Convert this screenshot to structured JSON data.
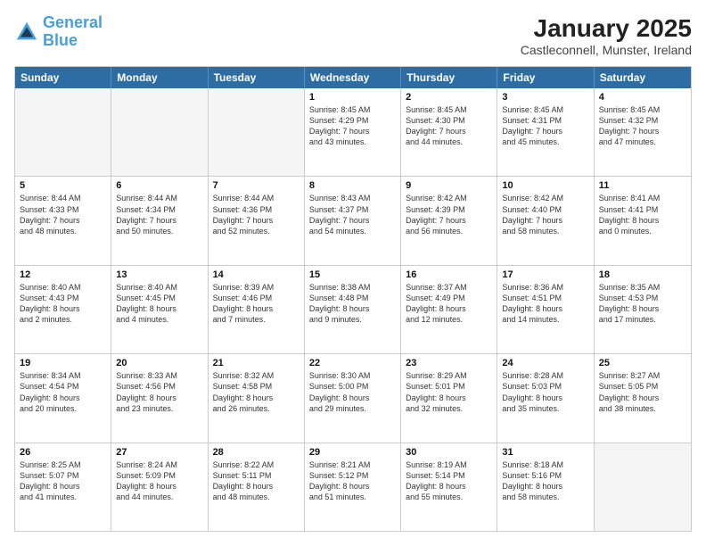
{
  "logo": {
    "line1": "General",
    "line2": "Blue"
  },
  "title": "January 2025",
  "location": "Castleconnell, Munster, Ireland",
  "header_days": [
    "Sunday",
    "Monday",
    "Tuesday",
    "Wednesday",
    "Thursday",
    "Friday",
    "Saturday"
  ],
  "weeks": [
    [
      {
        "day": "",
        "info": "",
        "empty": true
      },
      {
        "day": "",
        "info": "",
        "empty": true
      },
      {
        "day": "",
        "info": "",
        "empty": true
      },
      {
        "day": "1",
        "info": "Sunrise: 8:45 AM\nSunset: 4:29 PM\nDaylight: 7 hours\nand 43 minutes."
      },
      {
        "day": "2",
        "info": "Sunrise: 8:45 AM\nSunset: 4:30 PM\nDaylight: 7 hours\nand 44 minutes."
      },
      {
        "day": "3",
        "info": "Sunrise: 8:45 AM\nSunset: 4:31 PM\nDaylight: 7 hours\nand 45 minutes."
      },
      {
        "day": "4",
        "info": "Sunrise: 8:45 AM\nSunset: 4:32 PM\nDaylight: 7 hours\nand 47 minutes."
      }
    ],
    [
      {
        "day": "5",
        "info": "Sunrise: 8:44 AM\nSunset: 4:33 PM\nDaylight: 7 hours\nand 48 minutes."
      },
      {
        "day": "6",
        "info": "Sunrise: 8:44 AM\nSunset: 4:34 PM\nDaylight: 7 hours\nand 50 minutes."
      },
      {
        "day": "7",
        "info": "Sunrise: 8:44 AM\nSunset: 4:36 PM\nDaylight: 7 hours\nand 52 minutes."
      },
      {
        "day": "8",
        "info": "Sunrise: 8:43 AM\nSunset: 4:37 PM\nDaylight: 7 hours\nand 54 minutes."
      },
      {
        "day": "9",
        "info": "Sunrise: 8:42 AM\nSunset: 4:39 PM\nDaylight: 7 hours\nand 56 minutes."
      },
      {
        "day": "10",
        "info": "Sunrise: 8:42 AM\nSunset: 4:40 PM\nDaylight: 7 hours\nand 58 minutes."
      },
      {
        "day": "11",
        "info": "Sunrise: 8:41 AM\nSunset: 4:41 PM\nDaylight: 8 hours\nand 0 minutes."
      }
    ],
    [
      {
        "day": "12",
        "info": "Sunrise: 8:40 AM\nSunset: 4:43 PM\nDaylight: 8 hours\nand 2 minutes."
      },
      {
        "day": "13",
        "info": "Sunrise: 8:40 AM\nSunset: 4:45 PM\nDaylight: 8 hours\nand 4 minutes."
      },
      {
        "day": "14",
        "info": "Sunrise: 8:39 AM\nSunset: 4:46 PM\nDaylight: 8 hours\nand 7 minutes."
      },
      {
        "day": "15",
        "info": "Sunrise: 8:38 AM\nSunset: 4:48 PM\nDaylight: 8 hours\nand 9 minutes."
      },
      {
        "day": "16",
        "info": "Sunrise: 8:37 AM\nSunset: 4:49 PM\nDaylight: 8 hours\nand 12 minutes."
      },
      {
        "day": "17",
        "info": "Sunrise: 8:36 AM\nSunset: 4:51 PM\nDaylight: 8 hours\nand 14 minutes."
      },
      {
        "day": "18",
        "info": "Sunrise: 8:35 AM\nSunset: 4:53 PM\nDaylight: 8 hours\nand 17 minutes."
      }
    ],
    [
      {
        "day": "19",
        "info": "Sunrise: 8:34 AM\nSunset: 4:54 PM\nDaylight: 8 hours\nand 20 minutes."
      },
      {
        "day": "20",
        "info": "Sunrise: 8:33 AM\nSunset: 4:56 PM\nDaylight: 8 hours\nand 23 minutes."
      },
      {
        "day": "21",
        "info": "Sunrise: 8:32 AM\nSunset: 4:58 PM\nDaylight: 8 hours\nand 26 minutes."
      },
      {
        "day": "22",
        "info": "Sunrise: 8:30 AM\nSunset: 5:00 PM\nDaylight: 8 hours\nand 29 minutes."
      },
      {
        "day": "23",
        "info": "Sunrise: 8:29 AM\nSunset: 5:01 PM\nDaylight: 8 hours\nand 32 minutes."
      },
      {
        "day": "24",
        "info": "Sunrise: 8:28 AM\nSunset: 5:03 PM\nDaylight: 8 hours\nand 35 minutes."
      },
      {
        "day": "25",
        "info": "Sunrise: 8:27 AM\nSunset: 5:05 PM\nDaylight: 8 hours\nand 38 minutes."
      }
    ],
    [
      {
        "day": "26",
        "info": "Sunrise: 8:25 AM\nSunset: 5:07 PM\nDaylight: 8 hours\nand 41 minutes."
      },
      {
        "day": "27",
        "info": "Sunrise: 8:24 AM\nSunset: 5:09 PM\nDaylight: 8 hours\nand 44 minutes."
      },
      {
        "day": "28",
        "info": "Sunrise: 8:22 AM\nSunset: 5:11 PM\nDaylight: 8 hours\nand 48 minutes."
      },
      {
        "day": "29",
        "info": "Sunrise: 8:21 AM\nSunset: 5:12 PM\nDaylight: 8 hours\nand 51 minutes."
      },
      {
        "day": "30",
        "info": "Sunrise: 8:19 AM\nSunset: 5:14 PM\nDaylight: 8 hours\nand 55 minutes."
      },
      {
        "day": "31",
        "info": "Sunrise: 8:18 AM\nSunset: 5:16 PM\nDaylight: 8 hours\nand 58 minutes."
      },
      {
        "day": "",
        "info": "",
        "empty": true
      }
    ]
  ]
}
